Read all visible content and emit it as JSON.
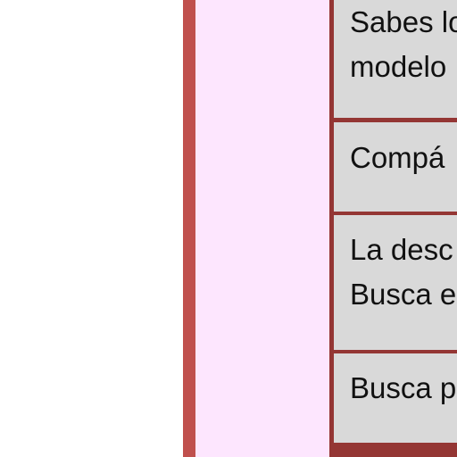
{
  "rows": [
    {
      "lines": [
        "Sabes lo",
        "modelo"
      ]
    },
    {
      "lines": [
        "Compá"
      ]
    },
    {
      "lines": [
        "La desc",
        "Busca e"
      ]
    },
    {
      "lines": [
        "Busca p"
      ]
    }
  ]
}
